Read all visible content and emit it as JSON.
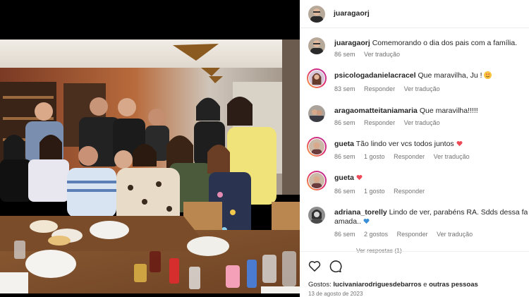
{
  "post": {
    "author": "juaragaorj"
  },
  "comments": [
    {
      "username": "juaragaorj",
      "text": "Comemorando o dia dos pais com a família.",
      "age": "86 sem",
      "likes": "",
      "actions": [
        "Ver tradução"
      ],
      "emoji": ""
    },
    {
      "username": "psicologadanielacracel",
      "text": "Que maravilha, Ju !",
      "age": "83 sem",
      "likes": "",
      "actions": [
        "Responder",
        "Ver tradução"
      ],
      "emoji": "heart-eyes"
    },
    {
      "username": "aragaomatteitaniamaria",
      "text": "Que maravilha!!!!!",
      "age": "86 sem",
      "likes": "",
      "actions": [
        "Responder",
        "Ver tradução"
      ],
      "emoji": ""
    },
    {
      "username": "gueta",
      "text": "Tão lindo ver vcs todos juntos",
      "age": "86 sem",
      "likes": "1 gosto",
      "actions": [
        "Responder",
        "Ver tradução"
      ],
      "emoji": "red-heart"
    },
    {
      "username": "gueta",
      "text": "",
      "age": "86 sem",
      "likes": "1 gosto",
      "actions": [
        "Responder"
      ],
      "emoji": "red-heart"
    },
    {
      "username": "adriana_torelly",
      "text": "Lindo de ver, parabéns RA. Sdds dessa família",
      "text2": "amada..",
      "age": "86 sem",
      "likes": "2 gostos",
      "actions": [
        "Responder",
        "Ver tradução"
      ],
      "emoji": "blue-heart"
    }
  ],
  "more_replies": "Ver respostas (1)",
  "likes_line": {
    "prefix": "Gostos:",
    "user": "lucivaniarodriguesdebarros",
    "connector": "e",
    "others": "outras pessoas"
  },
  "post_date": "13 de agosto de 2023",
  "icons": {
    "like": "heart-outline-icon",
    "comment": "comment-bubble-icon"
  },
  "colors": {
    "heart_red": "#ed4956",
    "meta_gray": "#737373",
    "text": "#262626",
    "blue_heart": "#3b8fd6"
  }
}
